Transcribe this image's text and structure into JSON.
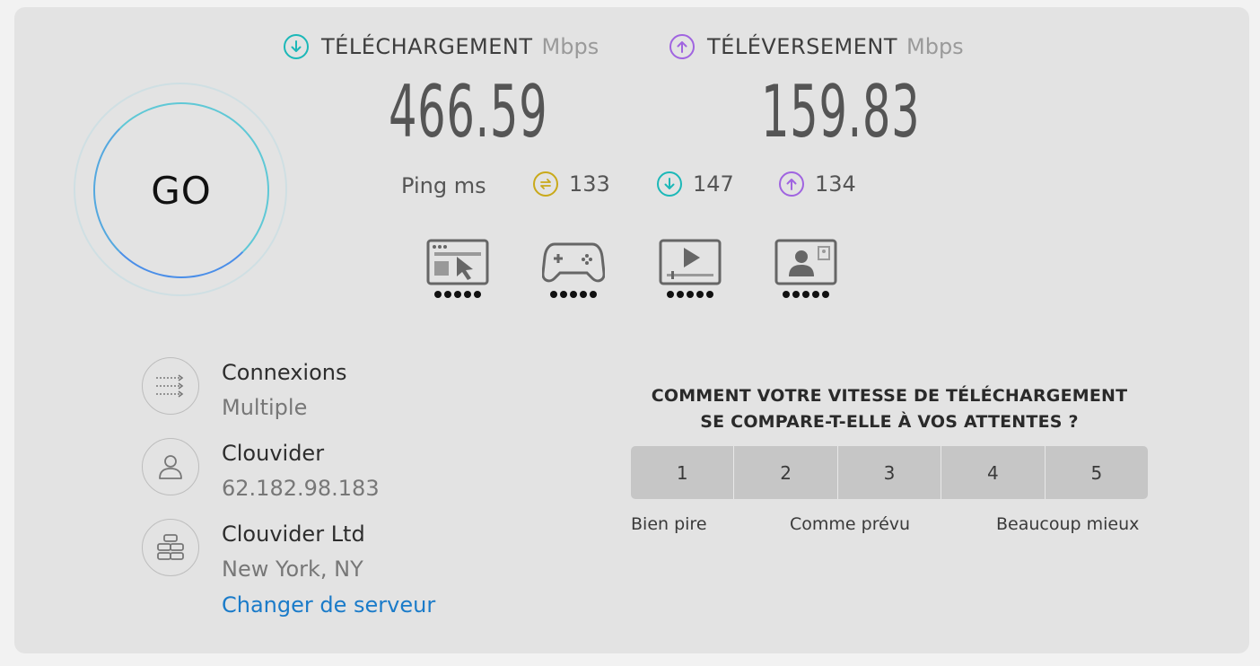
{
  "go": {
    "label": "GO"
  },
  "download": {
    "label": "TÉLÉCHARGEMENT",
    "unit": "Mbps",
    "value": "466.59",
    "color": "#1cb8b8"
  },
  "upload": {
    "label": "TÉLÉVERSEMENT",
    "unit": "Mbps",
    "value": "159.83",
    "color": "#a064e0"
  },
  "ping": {
    "label": "Ping ms",
    "idle": {
      "value": "133",
      "icon": "ping-idle-icon",
      "color": "#c9a91a"
    },
    "download": {
      "value": "147",
      "icon": "download-arrow-icon",
      "color": "#1cb8b8"
    },
    "upload": {
      "value": "134",
      "icon": "upload-arrow-icon",
      "color": "#a064e0"
    }
  },
  "quality": [
    {
      "icon": "web-browsing-icon",
      "rating": 5
    },
    {
      "icon": "gaming-icon",
      "rating": 5
    },
    {
      "icon": "video-streaming-icon",
      "rating": 5
    },
    {
      "icon": "video-call-icon",
      "rating": 5
    }
  ],
  "connections": {
    "title": "Connexions",
    "value": "Multiple"
  },
  "isp": {
    "title": "Clouvider",
    "ip": "62.182.98.183"
  },
  "server": {
    "title": "Clouvider Ltd",
    "location": "New York, NY",
    "change_link": "Changer de serveur"
  },
  "survey": {
    "question_line1": "COMMENT VOTRE VITESSE DE TÉLÉCHARGEMENT",
    "question_line2": "SE COMPARE-T-ELLE À VOS ATTENTES ?",
    "options": [
      "1",
      "2",
      "3",
      "4",
      "5"
    ],
    "scale_low": "Bien pire",
    "scale_mid": "Comme prévu",
    "scale_high": "Beaucoup mieux"
  }
}
